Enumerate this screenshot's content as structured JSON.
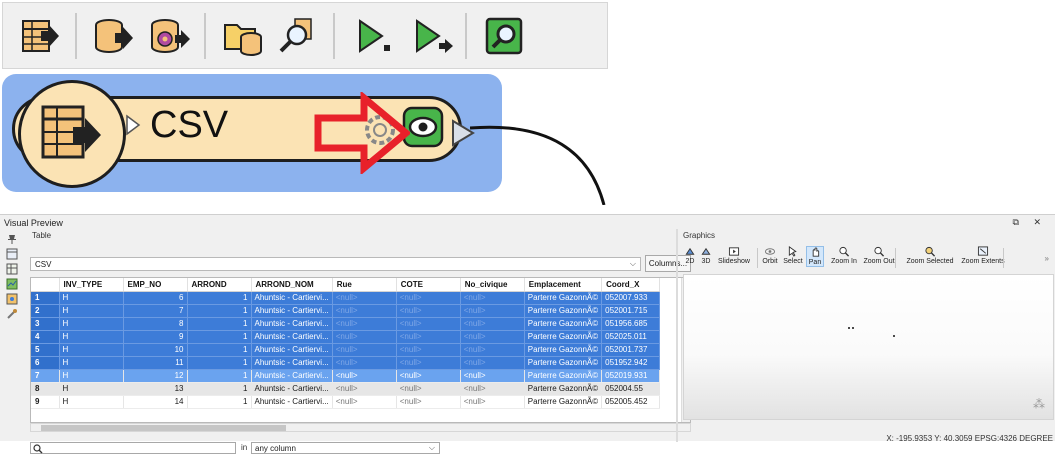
{
  "panel": {
    "title": "Visual Preview",
    "window_controls": "⧉ ✕"
  },
  "node": {
    "label": "CSV",
    "icon": "csv-reader-icon"
  },
  "toolbar": {
    "icons": [
      "table-export-icon",
      "database-export-icon",
      "database-settings-export-icon",
      "open-folder-database-icon",
      "search-icon",
      "run-icon",
      "run-to-icon",
      "inspect-icon"
    ]
  },
  "table": {
    "label": "Table",
    "source": "CSV",
    "columns_button": "Columns...",
    "headers": [
      "",
      "INV_TYPE",
      "EMP_NO",
      "ARROND",
      "ARROND_NOM",
      "Rue",
      "COTE",
      "No_civique",
      "Emplacement",
      "Coord_X"
    ],
    "rows": [
      {
        "n": "1",
        "state": "sel",
        "cells": [
          "H",
          "6",
          "1",
          "Ahuntsic - Cartiervi...",
          "<null>",
          "<null>",
          "<null>",
          "Parterre GazonnÃ©",
          "052007.933"
        ]
      },
      {
        "n": "2",
        "state": "sel",
        "cells": [
          "H",
          "7",
          "1",
          "Ahuntsic - Cartiervi...",
          "<null>",
          "<null>",
          "<null>",
          "Parterre GazonnÃ©",
          "052001.715"
        ]
      },
      {
        "n": "3",
        "state": "sel",
        "cells": [
          "H",
          "8",
          "1",
          "Ahuntsic - Cartiervi...",
          "<null>",
          "<null>",
          "<null>",
          "Parterre GazonnÃ©",
          "051956.685"
        ]
      },
      {
        "n": "4",
        "state": "sel",
        "cells": [
          "H",
          "9",
          "1",
          "Ahuntsic - Cartiervi...",
          "<null>",
          "<null>",
          "<null>",
          "Parterre GazonnÃ©",
          "052025.011"
        ]
      },
      {
        "n": "5",
        "state": "sel",
        "cells": [
          "H",
          "10",
          "1",
          "Ahuntsic - Cartiervi...",
          "<null>",
          "<null>",
          "<null>",
          "Parterre GazonnÃ©",
          "052001.737"
        ]
      },
      {
        "n": "6",
        "state": "sel",
        "cells": [
          "H",
          "11",
          "1",
          "Ahuntsic - Cartiervi...",
          "<null>",
          "<null>",
          "<null>",
          "Parterre GazonnÃ©",
          "051952.942"
        ]
      },
      {
        "n": "7",
        "state": "cur",
        "cells": [
          "H",
          "12",
          "1",
          "Ahuntsic - Cartiervi...",
          "<null>",
          "<null>",
          "<null>",
          "Parterre GazonnÃ©",
          "052019.931"
        ]
      },
      {
        "n": "8",
        "state": "gray",
        "cells": [
          "H",
          "13",
          "1",
          "Ahuntsic - Cartiervi...",
          "<null>",
          "<null>",
          "<null>",
          "Parterre GazonnÃ©",
          "052004.55"
        ]
      },
      {
        "n": "9",
        "state": "plain",
        "cells": [
          "H",
          "14",
          "1",
          "Ahuntsic - Cartiervi...",
          "<null>",
          "<null>",
          "<null>",
          "Parterre GazonnÃ©",
          "052005.452"
        ]
      }
    ],
    "search_in_label": "in",
    "search_column": "any column"
  },
  "graphics": {
    "label": "Graphics",
    "tools": [
      {
        "label": "2D",
        "icon": "view-2d-icon"
      },
      {
        "label": "3D",
        "icon": "view-3d-icon"
      },
      {
        "label": "Slideshow",
        "icon": "slideshow-icon"
      },
      {
        "label": "Orbit",
        "icon": "orbit-icon"
      },
      {
        "label": "Select",
        "icon": "select-icon"
      },
      {
        "label": "Pan",
        "icon": "pan-icon"
      },
      {
        "label": "Zoom In",
        "icon": "zoom-in-icon"
      },
      {
        "label": "Zoom Out",
        "icon": "zoom-out-icon"
      },
      {
        "label": "Zoom Selected",
        "icon": "zoom-selected-icon"
      },
      {
        "label": "Zoom Extents",
        "icon": "zoom-extents-icon"
      }
    ],
    "active_tool": "Pan",
    "more": "»",
    "coords": {
      "x_label": "X:",
      "x": "-195.9353",
      "y_label": "Y:",
      "y": "40.3059",
      "crs": "EPSG:4326 DEGREE"
    }
  },
  "colors": {
    "selection": "#3d7cd8",
    "node_fill": "#fbe3b4",
    "node_selection": "#8cb2ee",
    "arrow": "#e8212a"
  }
}
